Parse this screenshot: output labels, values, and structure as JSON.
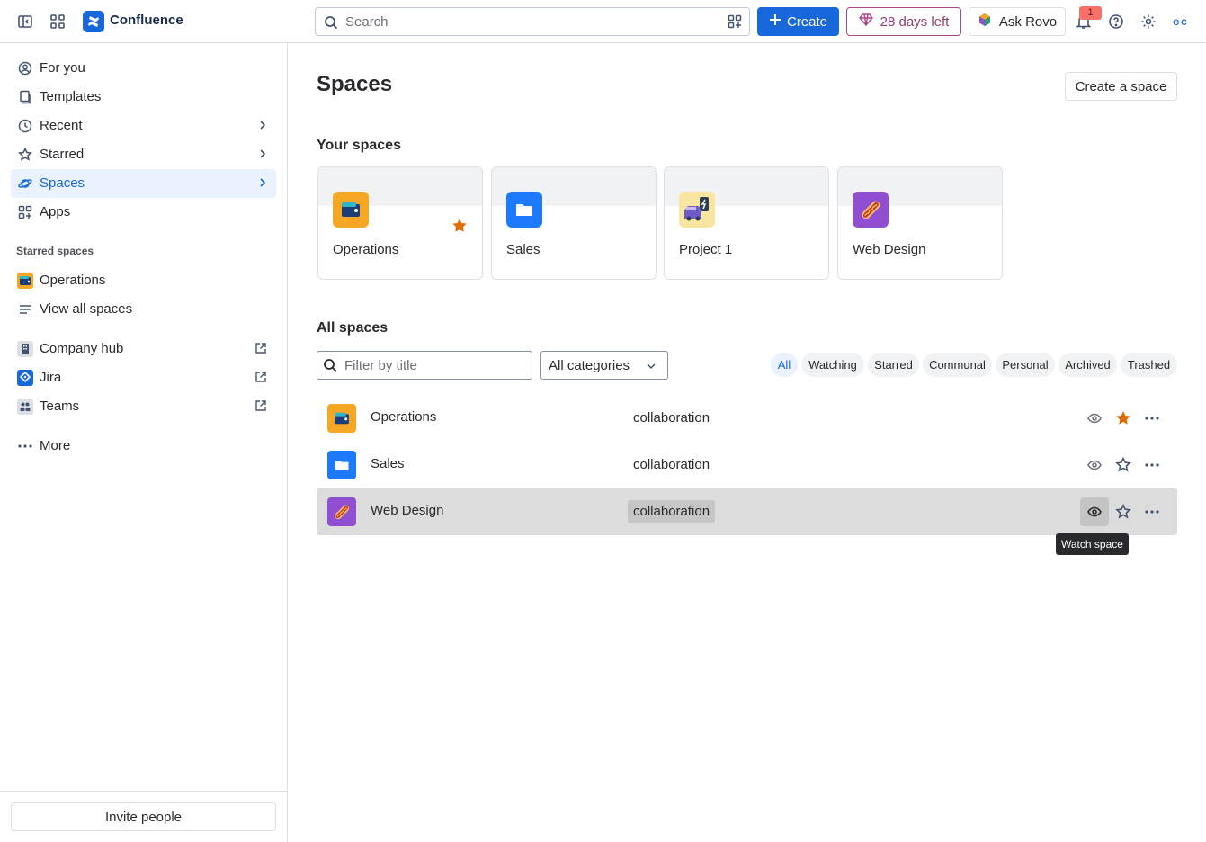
{
  "topbar": {
    "brand": "Confluence",
    "search_placeholder": "Search",
    "create_label": "Create",
    "trial_label": "28 days left",
    "rovo_label": "Ask Rovo",
    "notification_count": "1",
    "avatar_initials": "OC"
  },
  "sidebar": {
    "items": [
      {
        "label": "For you"
      },
      {
        "label": "Templates"
      },
      {
        "label": "Recent"
      },
      {
        "label": "Starred"
      },
      {
        "label": "Spaces"
      },
      {
        "label": "Apps"
      }
    ],
    "starred_section_title": "Starred spaces",
    "starred_spaces": [
      {
        "label": "Operations"
      },
      {
        "label": "View all spaces"
      }
    ],
    "apps": [
      {
        "label": "Company hub"
      },
      {
        "label": "Jira"
      },
      {
        "label": "Teams"
      }
    ],
    "more_label": "More",
    "invite_label": "Invite people"
  },
  "main": {
    "title": "Spaces",
    "create_space_label": "Create a space",
    "your_spaces_title": "Your spaces",
    "your_spaces": [
      {
        "name": "Operations",
        "starred": true,
        "color": "#f5a623"
      },
      {
        "name": "Sales",
        "starred": false,
        "color": "#1d7afc"
      },
      {
        "name": "Project 1",
        "starred": false,
        "color": "#f8e6a0"
      },
      {
        "name": "Web Design",
        "starred": false,
        "color": "#8f4fd0"
      }
    ],
    "all_spaces_title": "All spaces",
    "filter_placeholder": "Filter by title",
    "category_value": "All categories",
    "chips": [
      "All",
      "Watching",
      "Starred",
      "Communal",
      "Personal",
      "Archived",
      "Trashed"
    ],
    "active_chip": "All",
    "rows": [
      {
        "name": "Operations",
        "category": "collaboration",
        "starred": true
      },
      {
        "name": "Sales",
        "category": "collaboration",
        "starred": false
      },
      {
        "name": "Web Design",
        "category": "collaboration",
        "starred": false
      }
    ],
    "tooltip": "Watch space"
  },
  "colors": {
    "accent": "#1868db",
    "star": "#e06c00",
    "trial": "#ae4787"
  }
}
